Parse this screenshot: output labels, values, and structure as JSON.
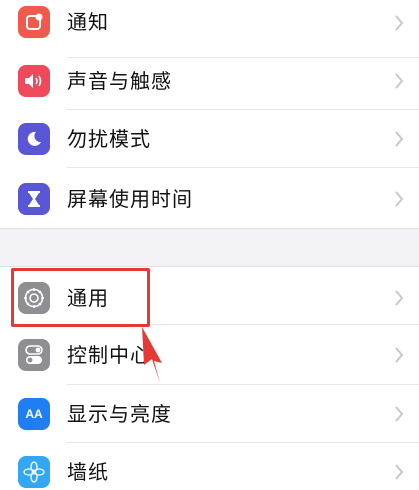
{
  "settings_top": [
    {
      "id": "notifications",
      "label": "通知",
      "icon": "notification-icon",
      "color": "#f05a4c"
    },
    {
      "id": "sounds",
      "label": "声音与触感",
      "icon": "speaker-icon",
      "color": "#ef4a5c"
    },
    {
      "id": "do-not-disturb",
      "label": "勿扰模式",
      "icon": "moon-icon",
      "color": "#5a57d6"
    },
    {
      "id": "screen-time",
      "label": "屏幕使用时间",
      "icon": "hourglass-icon",
      "color": "#5a57d6"
    }
  ],
  "settings_bottom": [
    {
      "id": "general",
      "label": "通用",
      "icon": "gear-icon",
      "color": "#8e8e93"
    },
    {
      "id": "control-center",
      "label": "控制中心",
      "icon": "toggle-switches-icon",
      "color": "#8e8e93"
    },
    {
      "id": "display",
      "label": "显示与亮度",
      "icon": "text-size-icon",
      "color": "#1f7ff2",
      "icon_text": "AA"
    },
    {
      "id": "wallpaper",
      "label": "墙纸",
      "icon": "flower-icon",
      "color": "#33a7f2"
    }
  ],
  "annotation": {
    "highlight_color": "#e53935"
  }
}
